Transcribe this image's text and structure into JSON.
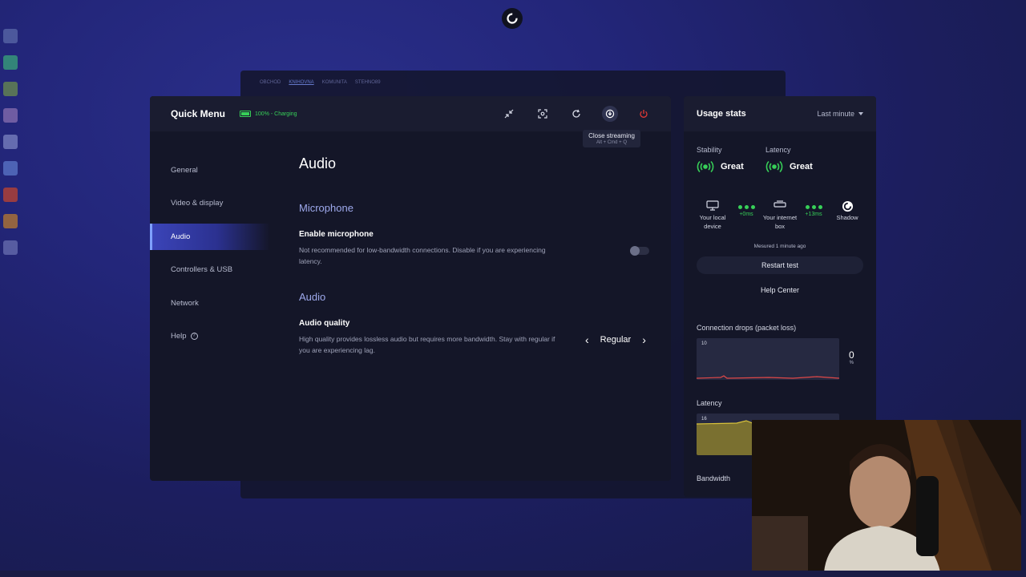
{
  "quick_menu": {
    "title": "Quick Menu",
    "battery": "100% - Charging",
    "tooltip": {
      "title": "Close streaming",
      "shortcut": "Alt + Cmd + Q"
    }
  },
  "background_window": {
    "tabs": [
      "OBCHOD",
      "KNIHOVNA",
      "KOMUNITA",
      "STEHNO89"
    ]
  },
  "sidebar": {
    "items": [
      {
        "label": "General"
      },
      {
        "label": "Video & display"
      },
      {
        "label": "Audio"
      },
      {
        "label": "Controllers & USB"
      },
      {
        "label": "Network"
      },
      {
        "label": "Help"
      }
    ]
  },
  "content": {
    "title": "Audio",
    "microphone_section": "Microphone",
    "enable_mic": {
      "name": "Enable microphone",
      "desc": "Not recommended for low-bandwidth connections. Disable if you are experiencing latency.",
      "enabled": false
    },
    "audio_section": "Audio",
    "audio_quality": {
      "name": "Audio quality",
      "desc": "High quality provides lossless audio but requires more bandwidth. Stay with regular if you are experiencing lag.",
      "value": "Regular"
    }
  },
  "usage": {
    "title": "Usage stats",
    "period": "Last minute",
    "stability_label": "Stability",
    "stability_value": "Great",
    "latency_label": "Latency",
    "latency_value": "Great",
    "route": {
      "local": "Your local device",
      "internet": "Your internet box",
      "shadow": "Shadow",
      "hop1_ms": "+0ms",
      "hop2_ms": "+13ms"
    },
    "measured": "Mesured 1 minute ago",
    "restart_label": "Restart test",
    "help_label": "Help Center",
    "drops_label": "Connection drops (packet loss)",
    "drops_max": "10",
    "drops_value": "0",
    "drops_unit": "%",
    "latency_graph_label": "Latency",
    "latency_max": "16",
    "bandwidth_label": "Bandwidth"
  },
  "colors": {
    "accent": "#7fa0ff",
    "good": "#37d058",
    "power": "#e53935",
    "panel": "#141628"
  }
}
